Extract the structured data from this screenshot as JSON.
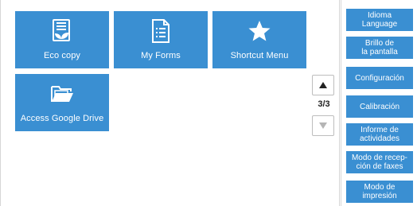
{
  "tiles": [
    {
      "label": "Eco copy",
      "icon": "eco-copy-icon"
    },
    {
      "label": "My Forms",
      "icon": "document-list-icon"
    },
    {
      "label": "Shortcut Menu",
      "icon": "star-icon"
    },
    {
      "label": "Access Google Drive",
      "icon": "folder-open-icon"
    }
  ],
  "pager": {
    "indicator": "3/3",
    "up_icon": "triangle-up-icon",
    "down_icon": "triangle-down-icon"
  },
  "side_menu": {
    "items": [
      {
        "label": "Idioma\nLanguage"
      },
      {
        "label": "Brillo de\nla pantalla"
      },
      {
        "label": "Configuración"
      },
      {
        "label": "Calibración"
      },
      {
        "label": "Informe de\nactividades"
      },
      {
        "label": "Modo de recep-\nción de faxes"
      },
      {
        "label": "Modo de\nimpresión"
      }
    ]
  },
  "colors": {
    "accent": "#3a8fd2",
    "tile_text": "#ffffff",
    "page_indicator": "#222222",
    "border": "#d6d6d6"
  }
}
